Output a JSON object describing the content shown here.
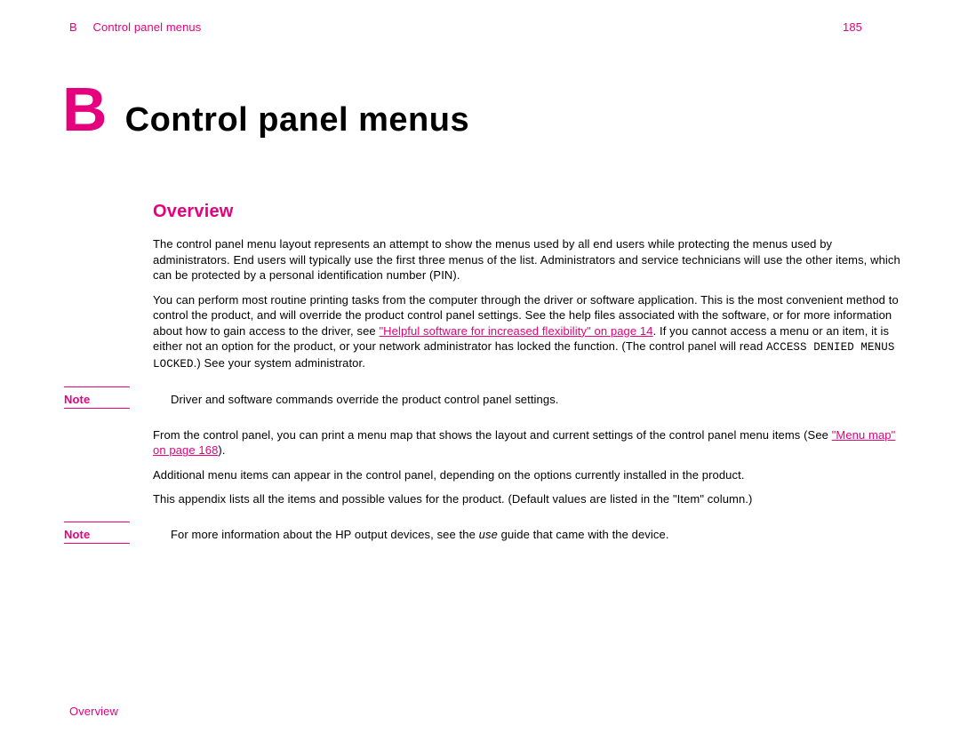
{
  "header": {
    "appendix_letter": "B",
    "title": "Control panel menus",
    "page_number": "185"
  },
  "title": {
    "letter": "B",
    "text": "Control panel menus"
  },
  "section": {
    "heading": "Overview",
    "para1": "The control panel menu layout represents an attempt to show the menus used by all end users while protecting the menus used by administrators. End users will typically use the first three menus of the list. Administrators and service technicians will use the other items, which can be protected by a personal identification number (PIN).",
    "para2_pre": "You can perform most routine printing tasks from the computer through the driver or software application. This is the most convenient method to control the product, and will override the product control panel settings. See the help files associated with the software, or for more information about how to gain access to the driver, see ",
    "link1_text": "\"Helpful software for increased flexibility\" on page 14",
    "para2_mid": ". If you cannot access a menu or an item, it is either not an option for the product, or your network administrator has locked the function. (The control panel will read ",
    "code1": "ACCESS DENIED MENUS LOCKED",
    "para2_post": ".) See your system administrator.",
    "note1_label": "Note",
    "note1_body": "Driver and software commands override the product control panel settings.",
    "para3_pre": "From the control panel, you can print a menu map that shows the layout and current settings of the control panel menu items (See ",
    "link2_text": "\"Menu map\" on page 168",
    "para3_post": ").",
    "para4": "Additional menu items can appear in the control panel, depending on the options currently installed in the product.",
    "para5": "This appendix lists all the items and possible values for the product. (Default values are listed in the \"Item\" column.)",
    "note2_label": "Note",
    "note2_body_pre": "For more information about the HP output devices, see the ",
    "note2_body_em": "use",
    "note2_body_post": " guide that came with the device."
  },
  "footer": {
    "text": "Overview"
  }
}
